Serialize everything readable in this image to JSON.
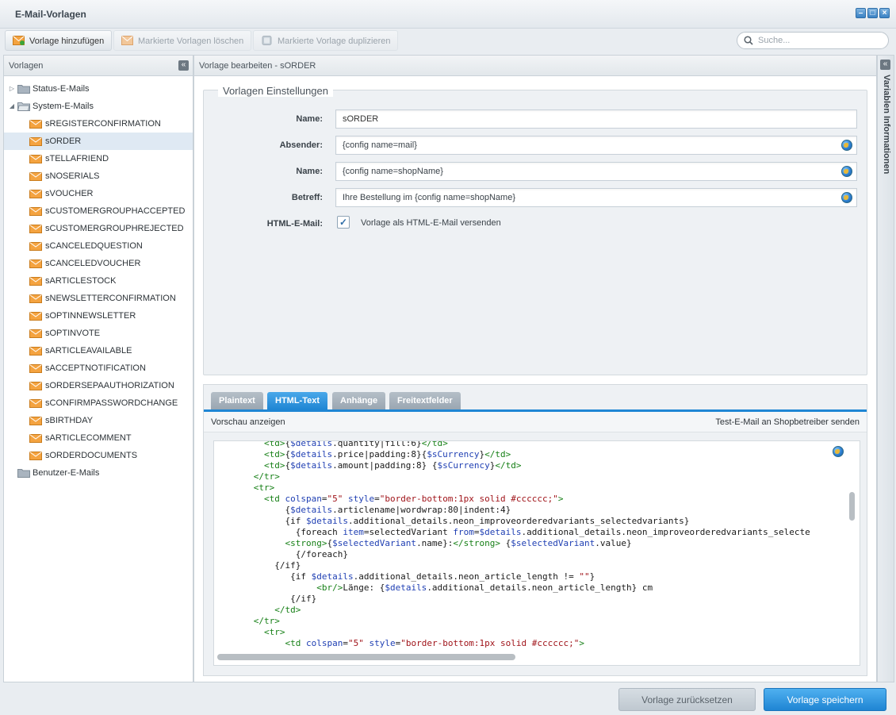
{
  "window": {
    "title": "E-Mail-Vorlagen",
    "controls": [
      "minimize",
      "maximize",
      "close"
    ]
  },
  "toolbar": {
    "add_label": "Vorlage hinzufügen",
    "delete_label": "Markierte Vorlagen löschen",
    "duplicate_label": "Markierte Vorlage duplizieren",
    "search_placeholder": "Suche..."
  },
  "tree": {
    "header": "Vorlagen",
    "status_folder": "Status-E-Mails",
    "system_folder": "System-E-Mails",
    "user_folder": "Benutzer-E-Mails",
    "selected": "sORDER",
    "items": [
      "sREGISTERCONFIRMATION",
      "sORDER",
      "sTELLAFRIEND",
      "sNOSERIALS",
      "sVOUCHER",
      "sCUSTOMERGROUPHACCEPTED",
      "sCUSTOMERGROUPHREJECTED",
      "sCANCELEDQUESTION",
      "sCANCELEDVOUCHER",
      "sARTICLESTOCK",
      "sNEWSLETTERCONFIRMATION",
      "sOPTINNEWSLETTER",
      "sOPTINVOTE",
      "sARTICLEAVAILABLE",
      "sACCEPTNOTIFICATION",
      "sORDERSEPAAUTHORIZATION",
      "sCONFIRMPASSWORDCHANGE",
      "sBIRTHDAY",
      "sARTICLECOMMENT",
      "sORDERDOCUMENTS"
    ]
  },
  "main": {
    "header": "Vorlage bearbeiten - sORDER",
    "legend": "Vorlagen Einstellungen",
    "fields": {
      "name_label": "Name:",
      "name_value": "sORDER",
      "sender_label": "Absender:",
      "sender_value": "{config name=mail}",
      "sender_name_label": "Name:",
      "sender_name_value": "{config name=shopName}",
      "subject_label": "Betreff:",
      "subject_value": "Ihre Bestellung im {config name=shopName}",
      "html_label": "HTML-E-Mail:",
      "html_checkbox_label": "Vorlage als HTML-E-Mail versenden",
      "html_checked": true
    },
    "tabs": [
      "Plaintext",
      "HTML-Text",
      "Anhänge",
      "Freitextfelder"
    ],
    "active_tab": "HTML-Text",
    "preview_label": "Vorschau anzeigen",
    "test_mail_label": "Test-E-Mail an Shopbetreiber senden",
    "code_lines": [
      "        <td>{$details.quantity|fill:6}</td>",
      "        <td>{$details.price|padding:8}{$sCurrency}</td>",
      "        <td>{$details.amount|padding:8} {$sCurrency}</td>",
      "      </tr>",
      "      <tr>",
      "        <td colspan=\"5\" style=\"border-bottom:1px solid #cccccc;\">",
      "            {$details.articlename|wordwrap:80|indent:4}",
      "            {if $details.additional_details.neon_improveorderedvariants_selectedvariants}",
      "              {foreach item=selectedVariant from=$details.additional_details.neon_improveorderedvariants_selecte",
      "            <strong>{$selectedVariant.name}:</strong> {$selectedVariant.value}",
      "              {/foreach}",
      "          {/if}",
      "             {if $details.additional_details.neon_article_length != \"\"}",
      "                  <br/>Länge: {$details.additional_details.neon_article_length} cm",
      "             {/if}",
      "          </td>",
      "      </tr>",
      "        <tr>",
      "            <td colspan=\"5\" style=\"border-bottom:1px solid #cccccc;\">"
    ]
  },
  "right_panel": {
    "title": "Variablen Informationen"
  },
  "footer": {
    "reset_label": "Vorlage zurücksetzen",
    "save_label": "Vorlage speichern"
  }
}
